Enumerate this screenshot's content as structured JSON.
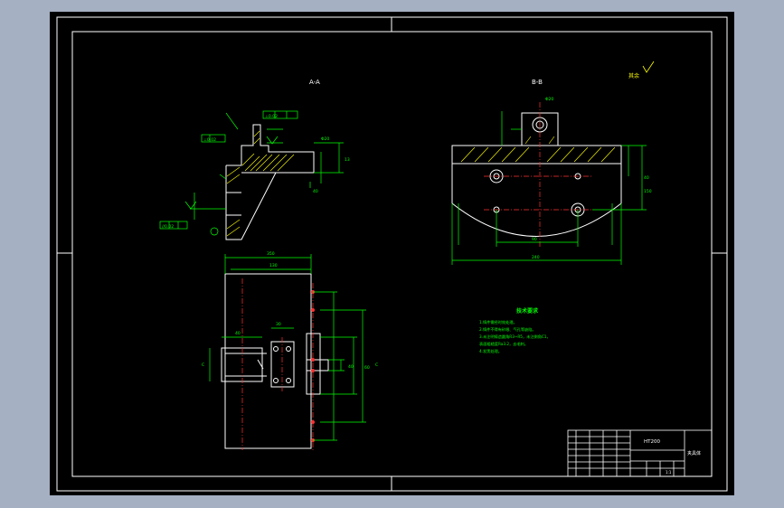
{
  "views": {
    "section_a": "A-A",
    "section_b": "B-B",
    "roughness_note": "其余"
  },
  "tech_requirements": {
    "title": "技术要求",
    "lines": [
      "1.铸件需经时效处理。",
      "2.铸件不得有砂眼、气孔等缺陷。",
      "3.未注明铸造圆角R3~R5，未注倒角C1，",
      "  表面粗糙度Ra3.2，去毛刺。",
      "4.发黑处理。"
    ]
  },
  "title_block": {
    "material": "HT200",
    "part_name": "夹具体",
    "scale": "1:1"
  },
  "dimensions": {
    "overall_width": "240",
    "overall_depth": "350",
    "b_height": "90",
    "b_center": "150",
    "hole_dia": "Φ20",
    "top_width": "130",
    "side_a": "60",
    "side_b": "40"
  },
  "colors": {
    "frame": "#ffffff",
    "geometry": "#ffffff",
    "dimension": "#00ff00",
    "center": "#ff3030",
    "hatch": "#ffff00",
    "hole": "#ffff00"
  }
}
